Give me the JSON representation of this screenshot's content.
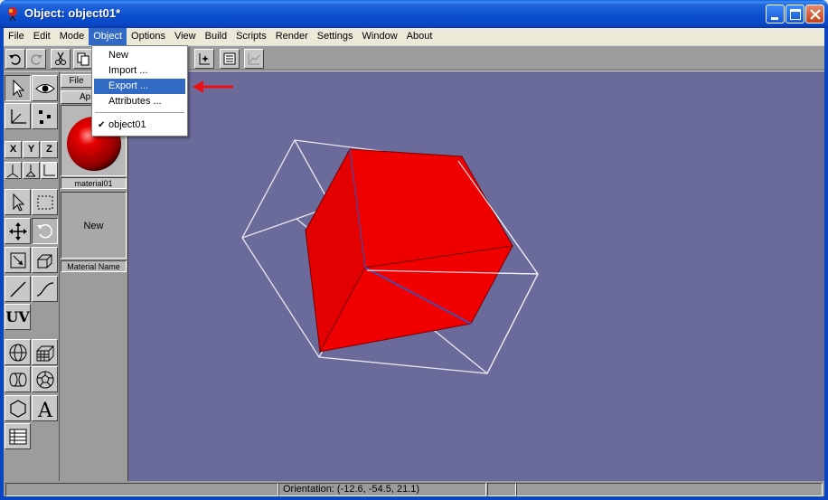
{
  "window": {
    "title": "Object: object01*"
  },
  "menu": [
    "File",
    "Edit",
    "Mode",
    "Object",
    "Options",
    "View",
    "Build",
    "Scripts",
    "Render",
    "Settings",
    "Window",
    "About"
  ],
  "active_menu": "Object",
  "object_menu": {
    "items": [
      "New",
      "Import ...",
      "Export ...",
      "Attributes ..."
    ],
    "highlighted": "Export ...",
    "objects": [
      "object01"
    ]
  },
  "tool_panel": {
    "axes": [
      "X",
      "Y",
      "Z"
    ],
    "uv_label": "UV"
  },
  "material_panel": {
    "tabs": [
      "File",
      "Ap"
    ],
    "material_name": "material01",
    "new_label": "New",
    "name_caption": "Material Name"
  },
  "status": {
    "orientation": "Orientation: (-12.6, -54.5, 21.1)"
  },
  "colors": {
    "viewport_bg": "#6b6b9b",
    "cube": "#ee0000",
    "highlight": "#316ac5",
    "annotation_arrow": "#e81010"
  }
}
